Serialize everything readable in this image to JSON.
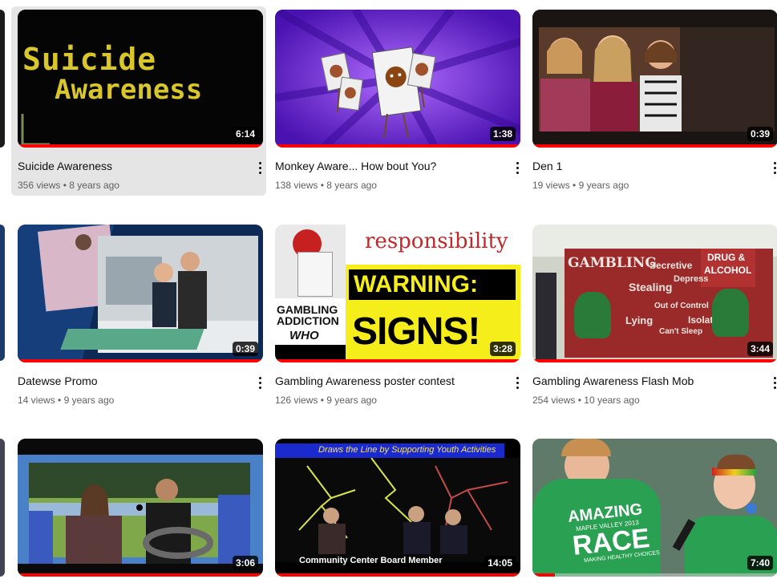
{
  "videos": [
    {
      "title": "Suicide Awareness",
      "views": "356 views",
      "age": "8 years ago",
      "duration": "6:14",
      "thumb_text_1": "Suicide",
      "thumb_text_2": "Awareness"
    },
    {
      "title": "Monkey Aware... How bout You?",
      "views": "138 views",
      "age": "8 years ago",
      "duration": "1:38"
    },
    {
      "title": "Den 1",
      "views": "19 views",
      "age": "9 years ago",
      "duration": "0:39"
    },
    {
      "title": "Datewse Promo",
      "views": "14 views",
      "age": "9 years ago",
      "duration": "0:39"
    },
    {
      "title": "Gambling Awareness poster contest",
      "views": "126 views",
      "age": "9 years ago",
      "duration": "3:28",
      "thumb_text_1": "responsibility",
      "thumb_text_2": "WARNING:",
      "thumb_text_3": "SIGNS!",
      "thumb_text_4": "GAMBLING",
      "thumb_text_5": "ADDICTION",
      "thumb_text_6": "WHO"
    },
    {
      "title": "Gambling Awareness Flash Mob",
      "views": "254 views",
      "age": "10 years ago",
      "duration": "3:44",
      "thumb_text_1": "GAMBLING",
      "thumb_text_2": "Secretive",
      "thumb_text_3": "DRUG &",
      "thumb_text_4": "ALCOHOL",
      "thumb_text_5": "Stealing",
      "thumb_text_6": "Depress",
      "thumb_text_7": "Out of Control",
      "thumb_text_8": "Lying",
      "thumb_text_9": "Isolat",
      "thumb_text_10": "Can't Sleep"
    },
    {
      "title": "",
      "views": "",
      "age": "",
      "duration": "3:06"
    },
    {
      "title": "",
      "views": "",
      "age": "",
      "duration": "14:05",
      "thumb_text_1": "Draws the Line by Supporting Youth Activities",
      "thumb_text_2": "Community Center Board Member"
    },
    {
      "title": "",
      "views": "",
      "age": "",
      "duration": "7:40",
      "thumb_text_1": "AMAZING",
      "thumb_text_2": "MAPLE VALLEY 2013",
      "thumb_text_3": "RACE",
      "thumb_text_4": "MAKING HEALTHY CHOICES"
    }
  ],
  "meta_separator": "•",
  "colors": {
    "progress": "#ff0000",
    "meta_text": "#606060",
    "hover_bg": "#e5e5e5"
  }
}
